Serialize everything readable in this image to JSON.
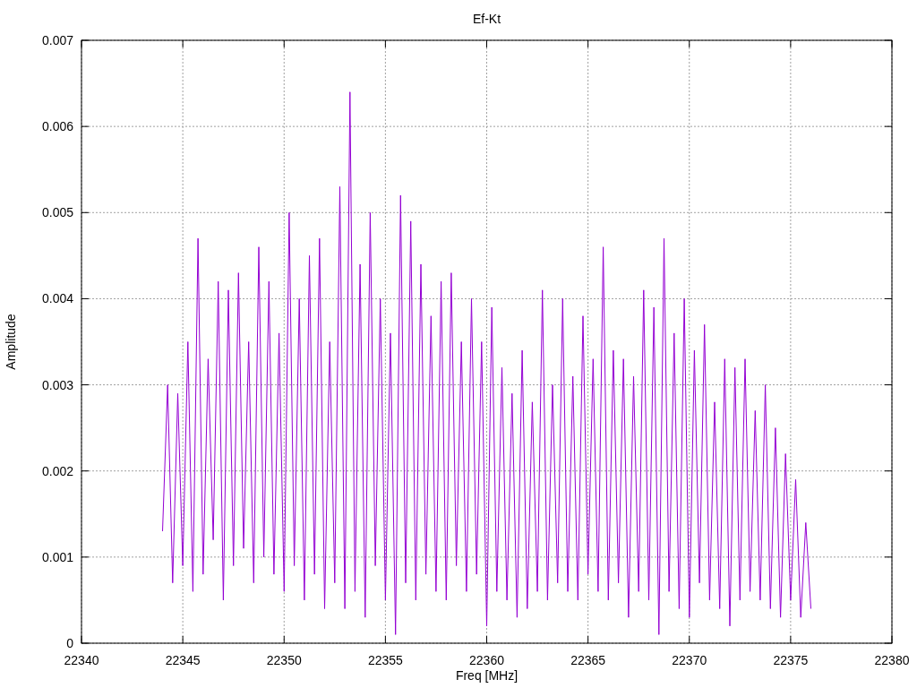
{
  "chart_data": {
    "type": "line",
    "title": "Ef-Kt",
    "xlabel": "Freq [MHz]",
    "ylabel": "Amplitude",
    "grid": true,
    "xlim": [
      22340,
      22380
    ],
    "ylim": [
      0,
      0.007
    ],
    "xticks": [
      22340,
      22345,
      22350,
      22355,
      22360,
      22365,
      22370,
      22375,
      22380
    ],
    "yticks": [
      {
        "value": 0,
        "label": "0"
      },
      {
        "value": 0.001,
        "label": "0.001"
      },
      {
        "value": 0.002,
        "label": "0.002"
      },
      {
        "value": 0.003,
        "label": "0.003"
      },
      {
        "value": 0.004,
        "label": "0.004"
      },
      {
        "value": 0.005,
        "label": "0.005"
      },
      {
        "value": 0.006,
        "label": "0.006"
      },
      {
        "value": 0.007,
        "label": "0.007"
      }
    ],
    "x": [
      22344,
      22344.25,
      22344.5,
      22344.75,
      22345,
      22345.25,
      22345.5,
      22345.75,
      22346,
      22346.25,
      22346.5,
      22346.75,
      22347,
      22347.25,
      22347.5,
      22347.75,
      22348,
      22348.25,
      22348.5,
      22348.75,
      22349,
      22349.25,
      22349.5,
      22349.75,
      22350,
      22350.25,
      22350.5,
      22350.75,
      22351,
      22351.25,
      22351.5,
      22351.75,
      22352,
      22352.25,
      22352.5,
      22352.75,
      22353,
      22353.25,
      22353.5,
      22353.75,
      22354,
      22354.25,
      22354.5,
      22354.75,
      22355,
      22355.25,
      22355.5,
      22355.75,
      22356,
      22356.25,
      22356.5,
      22356.75,
      22357,
      22357.25,
      22357.5,
      22357.75,
      22358,
      22358.25,
      22358.5,
      22358.75,
      22359,
      22359.25,
      22359.5,
      22359.75,
      22360,
      22360.25,
      22360.5,
      22360.75,
      22361,
      22361.25,
      22361.5,
      22361.75,
      22362,
      22362.25,
      22362.5,
      22362.75,
      22363,
      22363.25,
      22363.5,
      22363.75,
      22364,
      22364.25,
      22364.5,
      22364.75,
      22365,
      22365.25,
      22365.5,
      22365.75,
      22366,
      22366.25,
      22366.5,
      22366.75,
      22367,
      22367.25,
      22367.5,
      22367.75,
      22368,
      22368.25,
      22368.5,
      22368.75,
      22369,
      22369.25,
      22369.5,
      22369.75,
      22370,
      22370.25,
      22370.5,
      22370.75,
      22371,
      22371.25,
      22371.5,
      22371.75,
      22372,
      22372.25,
      22372.5,
      22372.75,
      22373,
      22373.25,
      22373.5,
      22373.75,
      22374,
      22374.25,
      22374.5,
      22374.75,
      22375,
      22375.25,
      22375.5,
      22375.75,
      22376
    ],
    "series": [
      {
        "color": "#9400d3",
        "values": [
          0.0013,
          0.003,
          0.0007,
          0.0029,
          0.0009,
          0.0035,
          0.0006,
          0.0047,
          0.0008,
          0.0033,
          0.0012,
          0.0042,
          0.0005,
          0.0041,
          0.0009,
          0.0043,
          0.0011,
          0.0035,
          0.0007,
          0.0046,
          0.001,
          0.0042,
          0.0008,
          0.0036,
          0.0006,
          0.005,
          0.0009,
          0.004,
          0.0005,
          0.0045,
          0.0008,
          0.0047,
          0.0004,
          0.0035,
          0.0007,
          0.0053,
          0.0004,
          0.0064,
          0.0006,
          0.0044,
          0.0003,
          0.005,
          0.0009,
          0.004,
          0.0005,
          0.0036,
          0.0001,
          0.0052,
          0.0007,
          0.0049,
          0.0005,
          0.0044,
          0.0008,
          0.0038,
          0.0006,
          0.0042,
          0.0005,
          0.0043,
          0.0009,
          0.0035,
          0.0006,
          0.004,
          0.0008,
          0.0035,
          0.0002,
          0.0039,
          0.0006,
          0.0032,
          0.0005,
          0.0029,
          0.0003,
          0.0034,
          0.0004,
          0.0028,
          0.0006,
          0.0041,
          0.0005,
          0.003,
          0.0007,
          0.004,
          0.0006,
          0.0031,
          0.0005,
          0.0038,
          0.0008,
          0.0033,
          0.0006,
          0.0046,
          0.0005,
          0.0034,
          0.0007,
          0.0033,
          0.0003,
          0.0031,
          0.0006,
          0.0041,
          0.0005,
          0.0039,
          0.0001,
          0.0047,
          0.0006,
          0.0036,
          0.0004,
          0.004,
          0.0003,
          0.0034,
          0.0007,
          0.0037,
          0.0005,
          0.0028,
          0.0004,
          0.0033,
          0.0002,
          0.0032,
          0.0005,
          0.0033,
          0.0006,
          0.0027,
          0.0005,
          0.003,
          0.0004,
          0.0025,
          0.0003,
          0.0022,
          0.0005,
          0.0019,
          0.0003,
          0.0014,
          0.0004
        ]
      }
    ]
  }
}
